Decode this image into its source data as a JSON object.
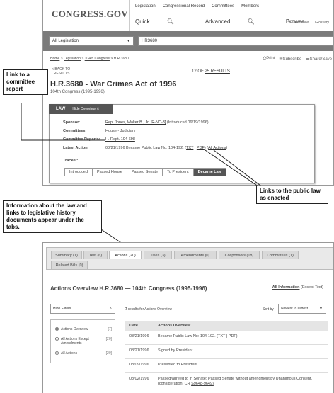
{
  "top": {
    "logo": "CONGRESS.GOV",
    "top_links": [
      "Legislation",
      "Congressional Record",
      "Committees",
      "Members"
    ],
    "nav": [
      "Quick",
      "Advanced",
      "Browse"
    ],
    "tools": [
      "Search Tools",
      "Glossary"
    ],
    "scope_select": "All Legislation",
    "search_value": "HR3680",
    "breadcrumb": [
      "Home",
      "Legislation",
      "104th Congress",
      "H.R.3680"
    ],
    "share": [
      "Print",
      "Subscribe",
      "Share/Save"
    ],
    "back_to": "BACK TO",
    "back_results": "RESULTS",
    "counter_prefix": "12 OF",
    "counter_link": "25 RESULTS",
    "bill_title": "H.R.3680 - War Crimes Act of 1996",
    "bill_subtitle": "104th Congress (1995-1996)",
    "law_tab": "LAW",
    "hide_overview": "Hide Overview",
    "sponsor_label": "Sponsor:",
    "sponsor_link": "Rep. Jones, Walter B., Jr. [R-NC-3]",
    "sponsor_rest": "(Introduced 06/19/1996)",
    "committees_label": "Committees:",
    "committees_value": "House - Judiciary",
    "reports_label": "Committee Reports:",
    "reports_value": "H. Rept. 104-698",
    "action_label": "Latest Action:",
    "action_text": "08/21/1996 Became Public Law No: 104-192.",
    "action_txt": "TXT",
    "action_pdf": "PDF",
    "action_all": "All Actions",
    "tracker_label": "Tracker:",
    "tracker_steps": [
      "Introduced",
      "Passed House",
      "Passed Senate",
      "To President",
      "Became Law"
    ]
  },
  "callouts": {
    "committee_report": "Link to a committee report",
    "public_law": "Links to the public law as enacted",
    "info_about": "Information about the law and links to legislative history documents appear under the tabs."
  },
  "bottom": {
    "tabs": [
      "Summary (1)",
      "Text (6)",
      "Actions (20)",
      "Titles (3)",
      "Amendments (0)",
      "Cosponsors (18)",
      "Committees (1)",
      "Related Bills (0)"
    ],
    "overview_title": "Actions Overview H.R.3680 — 104th Congress (1995-1996)",
    "all_info": "All Information",
    "except_text": "(Except Text)",
    "hide_filters": "Hide Filters",
    "filters": [
      {
        "label": "Actions Overview",
        "count": "[7]"
      },
      {
        "label": "All Actions Except Amendments",
        "count": "[20]"
      },
      {
        "label": "All Actions",
        "count": "[20]"
      }
    ],
    "results_count": "7",
    "results_text": "results for Actions Overview",
    "sort_label": "Sort by",
    "sort_value": "Newest to Oldest",
    "col_date": "Date",
    "col_actions": "Actions Overview",
    "rows": [
      {
        "date": "08/21/1996",
        "action": "Became Public Law No: 104-192.",
        "links": "(TXT | PDF)"
      },
      {
        "date": "08/21/1996",
        "action": "Signed by President.",
        "links": ""
      },
      {
        "date": "08/09/1996",
        "action": "Presented to President.",
        "links": ""
      },
      {
        "date": "08/02/1996",
        "action": "Passed/agreed to in Senate: Passed Senate without amendment by Unanimous Consent.(consideration: CR",
        "links": "S9648-9649)"
      }
    ]
  }
}
